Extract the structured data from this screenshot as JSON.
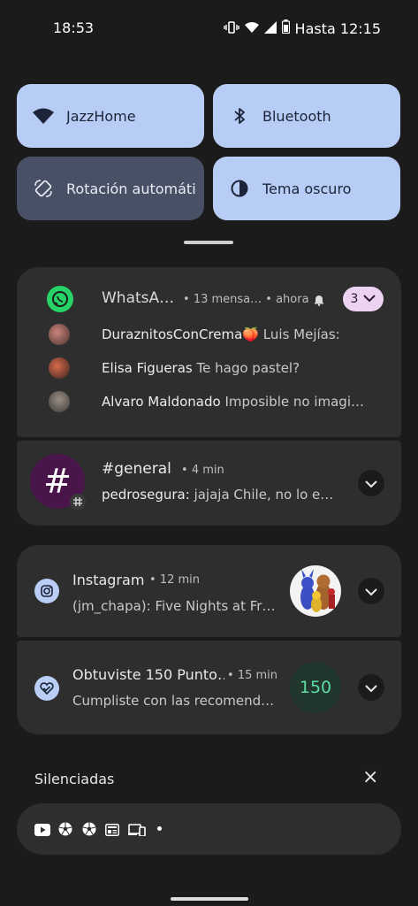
{
  "status_bar": {
    "time": "18:53",
    "battery_text": "Hasta 12:15",
    "icons": [
      "vibrate-icon",
      "wifi-icon",
      "signal-icon",
      "battery-icon"
    ]
  },
  "quick_settings": {
    "tiles": [
      {
        "label": "JazzHome",
        "icon": "wifi-icon",
        "state": "on"
      },
      {
        "label": "Bluetooth",
        "icon": "bluetooth-icon",
        "state": "on"
      },
      {
        "label": "Rotación automáti",
        "icon": "rotate-icon",
        "state": "off"
      },
      {
        "label": "Tema oscuro",
        "icon": "dark-theme-icon",
        "state": "on"
      }
    ]
  },
  "notifications": {
    "whatsapp": {
      "app": "WhatsA…",
      "count_text": "13 mensa…",
      "time": "ahora",
      "badge": "3",
      "messages": [
        {
          "sender": "DuraznitosConCrema🍑",
          "text": "Luis Mejías:"
        },
        {
          "sender": "Elisa Figueras",
          "text": "Te hago pastel?"
        },
        {
          "sender": "Alvaro Maldonado",
          "text": "Imposible no imagi…"
        }
      ]
    },
    "slack": {
      "channel": "#general",
      "time": "4 min",
      "sender": "pedrosegura:",
      "text": "jajaja Chile, no lo e…",
      "avatar_glyph": "#"
    },
    "instagram": {
      "app": "Instagram",
      "time": "12 min",
      "text": "(jm_chapa): Five Nights at Fr…"
    },
    "health": {
      "title": "Obtuviste 150 Punto…",
      "time": "15 min",
      "text": "Cumpliste con las recomend…",
      "points": "150"
    }
  },
  "silenced": {
    "label": "Silenciadas",
    "close": "×",
    "icons": [
      "youtube-icon",
      "soccer-icon",
      "soccer-icon",
      "news-icon",
      "devices-icon",
      "more-dot-icon"
    ]
  },
  "colors": {
    "background": "#1b1b1b",
    "card": "#2e2e2e",
    "tile_on": "#b8cdf5",
    "tile_off": "#475064",
    "whatsapp_green": "#25d366",
    "slack_purple": "#4a154b",
    "health_green": "#5fdba6"
  }
}
